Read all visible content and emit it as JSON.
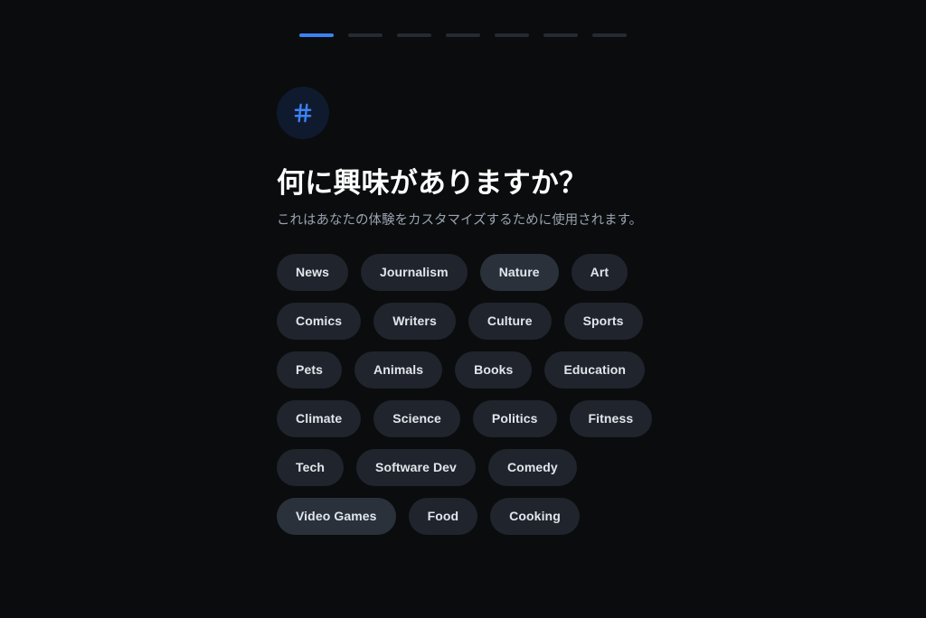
{
  "progress": {
    "total_steps": 7,
    "current_step": 1,
    "active_color": "#3b82f6",
    "inactive_color": "#262b33",
    "segments": [
      {
        "state": "active"
      },
      {
        "state": "inactive"
      },
      {
        "state": "inactive"
      },
      {
        "state": "inactive"
      },
      {
        "state": "inactive"
      },
      {
        "state": "inactive"
      },
      {
        "state": "inactive"
      }
    ]
  },
  "header": {
    "icon": "hashtag-icon",
    "icon_color": "#3b82f6",
    "badge_color": "#101a2e",
    "title": "何に興味がありますか？",
    "subtitle": "これはあなたの体験をカスタマイズするために使用されます。"
  },
  "interests": {
    "chip_color": "#20242c",
    "chip_highlight_color": "#2b313b",
    "items": [
      {
        "label": "News",
        "state": "default"
      },
      {
        "label": "Journalism",
        "state": "default"
      },
      {
        "label": "Nature",
        "state": "highlight"
      },
      {
        "label": "Art",
        "state": "default"
      },
      {
        "label": "Comics",
        "state": "default"
      },
      {
        "label": "Writers",
        "state": "default"
      },
      {
        "label": "Culture",
        "state": "default"
      },
      {
        "label": "Sports",
        "state": "default"
      },
      {
        "label": "Pets",
        "state": "default"
      },
      {
        "label": "Animals",
        "state": "default"
      },
      {
        "label": "Books",
        "state": "default"
      },
      {
        "label": "Education",
        "state": "default"
      },
      {
        "label": "Climate",
        "state": "default"
      },
      {
        "label": "Science",
        "state": "default"
      },
      {
        "label": "Politics",
        "state": "default"
      },
      {
        "label": "Fitness",
        "state": "default"
      },
      {
        "label": "Tech",
        "state": "default"
      },
      {
        "label": "Software Dev",
        "state": "default"
      },
      {
        "label": "Comedy",
        "state": "default"
      },
      {
        "label": "Video Games",
        "state": "highlight"
      },
      {
        "label": "Food",
        "state": "default"
      },
      {
        "label": "Cooking",
        "state": "default"
      }
    ]
  }
}
